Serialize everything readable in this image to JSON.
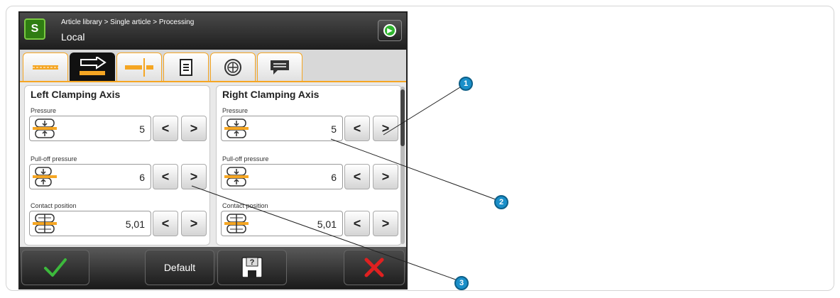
{
  "header": {
    "app_icon_text": "S",
    "breadcrumb": "Article library > Single article > Processing",
    "title": "Local",
    "nav_icon": "arrow-right-circle-icon"
  },
  "tabs": [
    {
      "icon": "axis-overview-icon",
      "active": false
    },
    {
      "icon": "clamp-forward-icon",
      "active": true
    },
    {
      "icon": "clamp-right-icon",
      "active": false
    },
    {
      "icon": "document-list-icon",
      "active": false
    },
    {
      "icon": "dial-icon",
      "active": false
    },
    {
      "icon": "message-icon",
      "active": false
    }
  ],
  "left_panel": {
    "title": "Left Clamping Axis",
    "fields": [
      {
        "label": "Pressure",
        "value": "5",
        "icon": "pressure-icon"
      },
      {
        "label": "Pull-off pressure",
        "value": "6",
        "icon": "pull-off-pressure-icon"
      },
      {
        "label": "Contact position",
        "value": "5,01",
        "icon": "contact-position-icon"
      }
    ]
  },
  "right_panel": {
    "title": "Right Clamping Axis",
    "fields": [
      {
        "label": "Pressure",
        "value": "5",
        "icon": "pressure-icon"
      },
      {
        "label": "Pull-off pressure",
        "value": "6",
        "icon": "pull-off-pressure-icon"
      },
      {
        "label": "Contact position",
        "value": "5,01",
        "icon": "contact-position-icon"
      }
    ]
  },
  "arrows": {
    "decrease": "<",
    "increase": ">"
  },
  "footer": {
    "confirm_icon": "checkmark-icon",
    "default_label": "Default",
    "save_icon": "save-help-icon",
    "cancel_icon": "cancel-x-icon"
  },
  "callouts": [
    "1",
    "2",
    "3"
  ],
  "colors": {
    "accent": "#f5a623",
    "confirm": "#3cb93c",
    "cancel": "#e02020",
    "callout": "#1a8fc9"
  }
}
